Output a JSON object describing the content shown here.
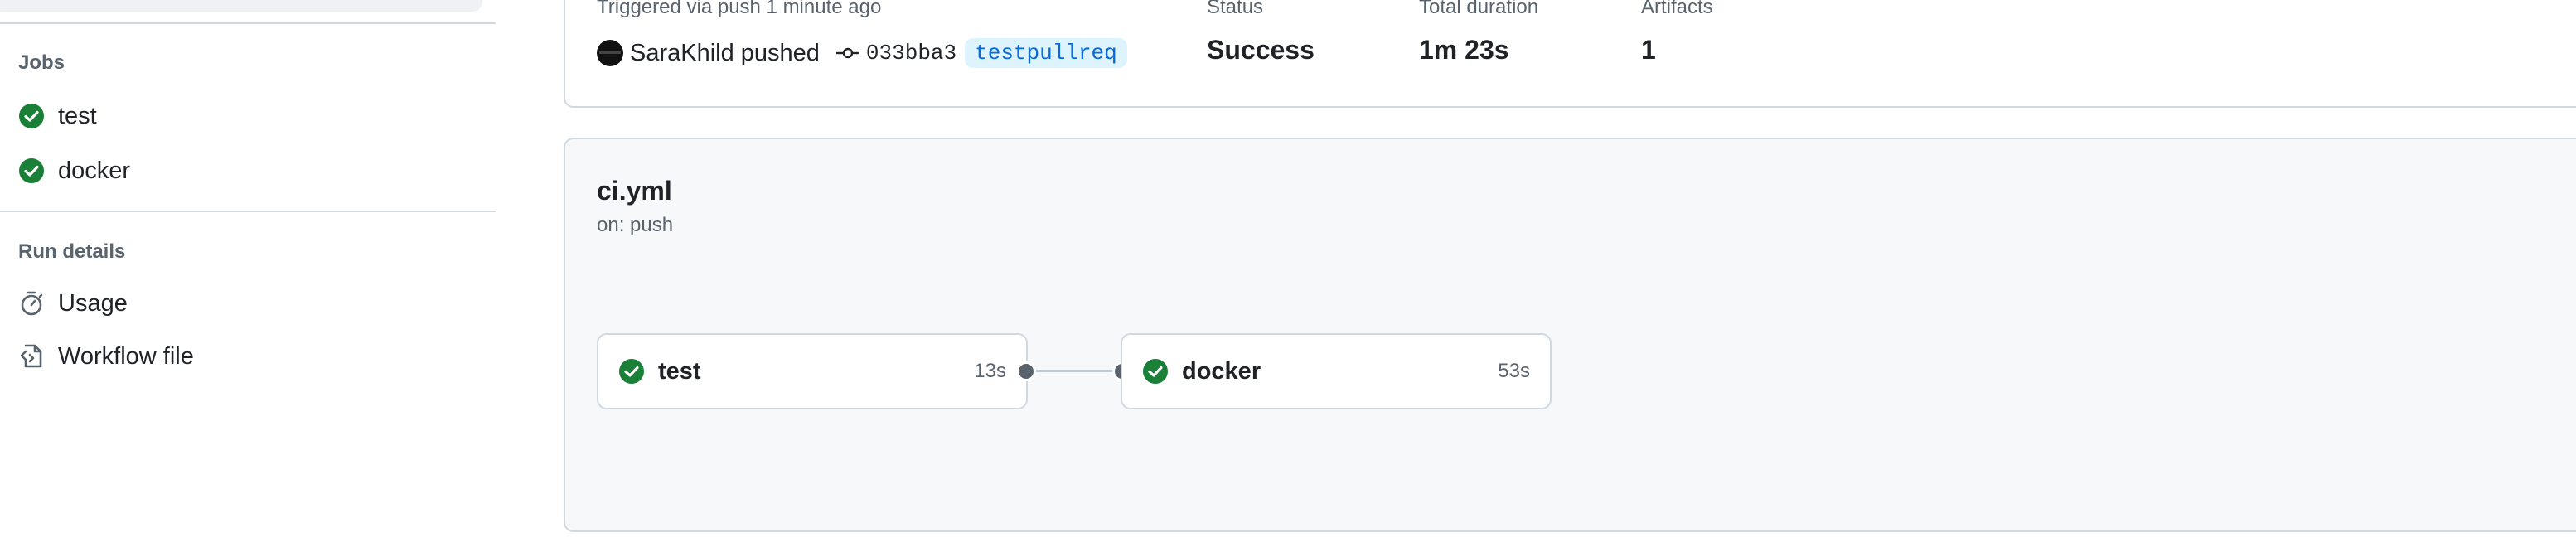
{
  "sidebar": {
    "jobs_title": "Jobs",
    "jobs": [
      {
        "label": "test",
        "status": "success"
      },
      {
        "label": "docker",
        "status": "success"
      }
    ],
    "run_details_title": "Run details",
    "run_details": [
      {
        "label": "Usage",
        "icon": "stopwatch-icon"
      },
      {
        "label": "Workflow file",
        "icon": "file-code-icon"
      }
    ]
  },
  "summary": {
    "trigger_label": "Triggered via push 1 minute ago",
    "actor": "SaraKhild",
    "action": "pushed",
    "commit": "033bba3",
    "branch": "testpullreq",
    "status_label": "Status",
    "status_value": "Success",
    "duration_label": "Total duration",
    "duration_value": "1m 23s",
    "artifacts_label": "Artifacts",
    "artifacts_value": "1"
  },
  "workflow": {
    "file": "ci.yml",
    "trigger": "on: push",
    "jobs": [
      {
        "name": "test",
        "duration": "13s"
      },
      {
        "name": "docker",
        "duration": "53s"
      }
    ]
  },
  "colors": {
    "success": "#1a7f37",
    "accent": "#0969da",
    "muted": "#59636e"
  }
}
